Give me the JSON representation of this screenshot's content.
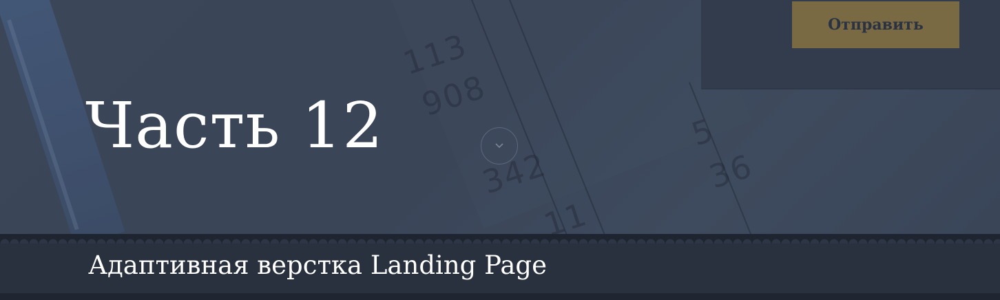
{
  "form_panel": {
    "submit_label": "Отправить"
  },
  "hero": {
    "title": "Часть 12",
    "background_numbers": [
      "113",
      "908",
      "342",
      "36",
      "5",
      "11"
    ]
  },
  "subtitle_bar": {
    "subtitle": "Адаптивная верстка Landing Page"
  },
  "icons": {
    "scroll": "chevron-down-icon"
  },
  "colors": {
    "background": "#3a4658",
    "accent_button": "#7a6a44",
    "bar": "#2a313e",
    "text": "#ffffff"
  }
}
